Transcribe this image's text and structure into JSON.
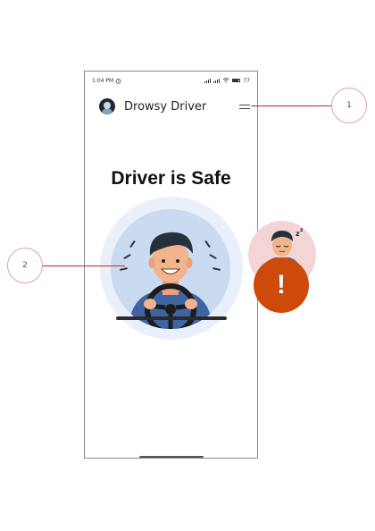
{
  "status_bar": {
    "time": "1:04 PM",
    "alarm_icon": "alarm-clock-icon",
    "battery_text": "77"
  },
  "app_bar": {
    "title": "Drowsy Driver",
    "logo_icon": "driver-avatar-icon",
    "menu_icon": "hamburger-menu-icon"
  },
  "main": {
    "status_text": "Driver is Safe",
    "hero_illustration": "smiling-driver-illustration"
  },
  "alert_illustration": {
    "icon": "drowsy-driver-illustration",
    "badge_icon": "exclamation-warning-icon",
    "badge_text": "!"
  },
  "callouts": [
    {
      "label": "1"
    },
    {
      "label": "2"
    }
  ],
  "colors": {
    "hero_bg": "#e9f0fb",
    "hero_inner": "#c9daf1",
    "warning": "#cd4a0a",
    "callout_line": "#c0262d"
  }
}
